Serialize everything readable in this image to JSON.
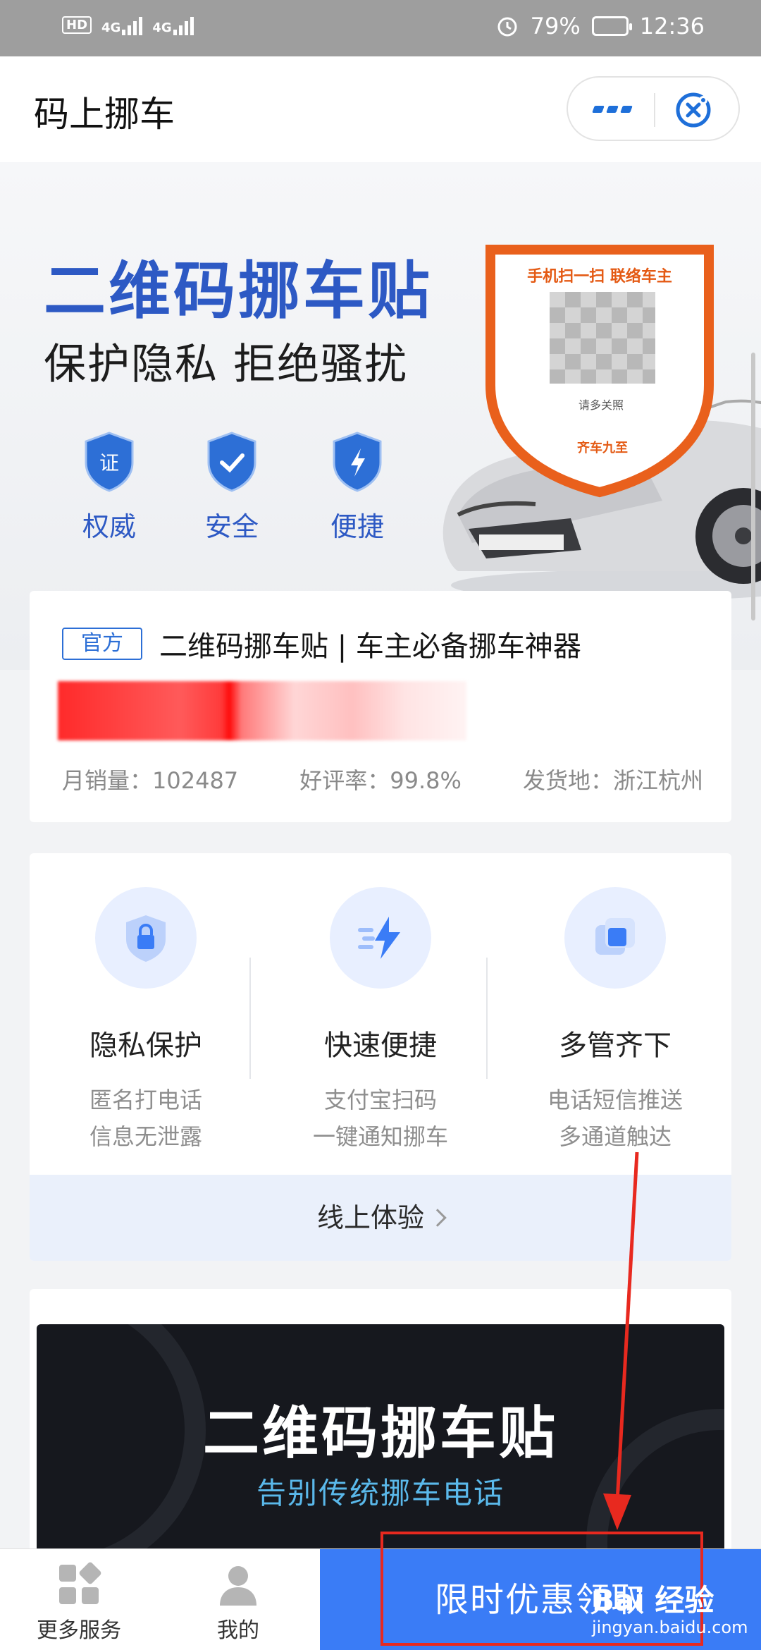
{
  "status_bar": {
    "hd": "HD",
    "network1": "4G",
    "network2": "4G",
    "battery": "79%",
    "time": "12:36"
  },
  "title_bar": {
    "title": "码上挪车"
  },
  "hero": {
    "title": "二维码挪车贴",
    "subtitle": "保护隐私 拒绝骚扰",
    "badges": [
      {
        "icon": "certificate-shield-icon",
        "badge_text": "证",
        "label": "权威"
      },
      {
        "icon": "check-shield-icon",
        "label": "安全"
      },
      {
        "icon": "lightning-shield-icon",
        "label": "便捷"
      }
    ],
    "sticker": {
      "headline": "手机扫一扫  联络车主",
      "note": "请多关照",
      "brand": "齐车九至"
    }
  },
  "product": {
    "tag": "官方",
    "name": "二维码挪车贴 | 车主必备挪车神器",
    "monthly_sales": "月销量：102487",
    "rating": "好评率：99.8%",
    "ship_from": "发货地：浙江杭州"
  },
  "features": {
    "items": [
      {
        "icon": "lock-shield-icon",
        "title": "隐私保护",
        "desc1": "匿名打电话",
        "desc2": "信息无泄露"
      },
      {
        "icon": "lightning-icon",
        "title": "快速便捷",
        "desc1": "支付宝扫码",
        "desc2": "一键通知挪车"
      },
      {
        "icon": "layers-icon",
        "title": "多管齐下",
        "desc1": "电话短信推送",
        "desc2": "多通道触达"
      }
    ],
    "try_online": "线上体验"
  },
  "promo": {
    "title": "二维码挪车贴",
    "subtitle": "告别传统挪车电话"
  },
  "bottom_bar": {
    "more_services": "更多服务",
    "mine": "我的",
    "cta": "限时优惠领取"
  },
  "watermark": {
    "main": "Bai 经验",
    "url": "jingyan.baidu.com"
  },
  "colors": {
    "brand_blue": "#2d59c4",
    "cta_blue": "#3a7cf6",
    "sticker_orange": "#e45a14",
    "annotation_red": "#e8291f"
  }
}
